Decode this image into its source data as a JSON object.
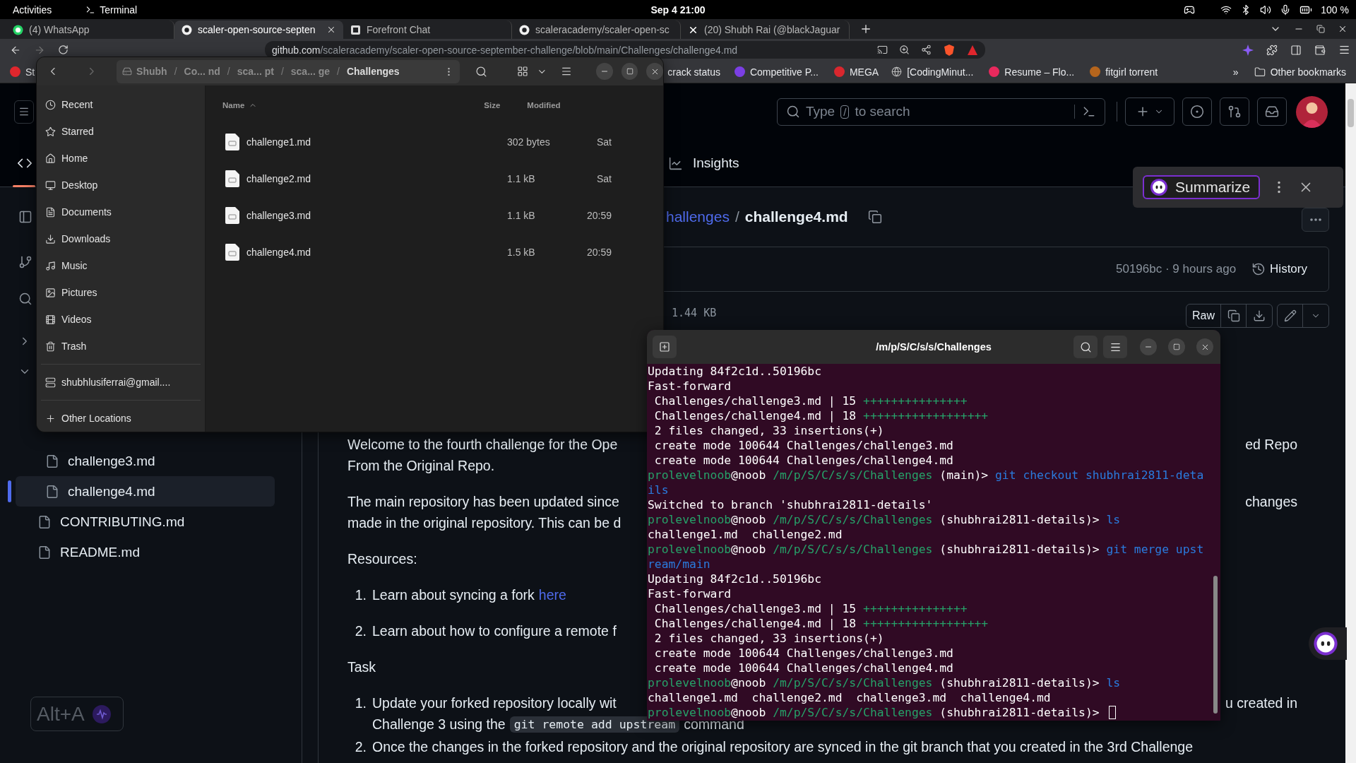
{
  "top_bar": {
    "activities": "Activities",
    "app": "Terminal",
    "clock": "Sep 4 21:00",
    "battery": "100 %"
  },
  "browser": {
    "tabs": [
      {
        "title": "(4) WhatsApp",
        "kind": "chat",
        "selected": false
      },
      {
        "title": "scaler-open-source-septen",
        "kind": "github",
        "selected": true
      },
      {
        "title": "Forefront Chat",
        "kind": "forefront",
        "selected": false
      },
      {
        "title": "scaleracademy/scaler-open-sc",
        "kind": "github",
        "selected": false
      },
      {
        "title": "(20) Shubh Rai (@blackJaguar",
        "kind": "x",
        "selected": false
      }
    ],
    "url": {
      "host": "github.com",
      "path": "/scaleracademy/scaler-open-source-september-challenge/blob/main/Challenges/challenge4.md"
    },
    "bookmarks": [
      {
        "label": "St",
        "kind": "dot",
        "color": "#e0262d"
      },
      {
        "label": "crack status",
        "kind": "none"
      },
      {
        "label": "Competitive P...",
        "kind": "dot",
        "color": "#7b3fe4"
      },
      {
        "label": "MEGA",
        "kind": "dot",
        "color": "#d9272e"
      },
      {
        "label": "[CodingMinut...",
        "kind": "globe"
      },
      {
        "label": "Resume – Flo...",
        "kind": "dot",
        "color": "#e8295d"
      },
      {
        "label": "fitgirl torrent",
        "kind": "dot",
        "color": "#b5651d"
      }
    ],
    "more": "»",
    "other_bookmarks": "Other bookmarks"
  },
  "github": {
    "search": {
      "before": "Type",
      "key": "/",
      "after": "to search"
    },
    "insights": "Insights",
    "breadcrumb": {
      "parent": "hallenges",
      "separator": "/",
      "file": "challenge4.md"
    },
    "commit": {
      "info": "50196bc · 9 hours ago",
      "history": "History"
    },
    "file_size": "1.44 KB",
    "raw": "Raw",
    "file_tree": [
      {
        "children": [
          {
            "name": "challenge3.md",
            "selected": false
          },
          {
            "name": "challenge4.md",
            "selected": true
          }
        ]
      },
      {
        "name": "CONTRIBUTING.md",
        "selected": false
      },
      {
        "name": "README.md",
        "selected": false
      }
    ],
    "content": [
      {
        "kind": "paragraph",
        "lines": [
          {
            "text": "Welcome to the fourth challenge for the Ope",
            "right": "ed Repo"
          },
          {
            "text": "From the Original Repo."
          }
        ]
      },
      {
        "kind": "paragraph",
        "lines": [
          {
            "text": "The main repository has been updated since",
            "right": "changes"
          },
          {
            "text": "made in the original repository. This can be d"
          }
        ]
      },
      {
        "kind": "paragraph",
        "lines": [
          {
            "text": "Resources:"
          }
        ]
      },
      {
        "kind": "list",
        "loose": true,
        "items": [
          {
            "number": "1.",
            "lines": [
              {
                "text": "Learn about syncing a fork",
                "link": "here"
              }
            ]
          },
          {
            "number": "2.",
            "lines": [
              {
                "text": "Learn about how to configure a remote f"
              }
            ]
          }
        ]
      },
      {
        "kind": "paragraph",
        "lines": [
          {
            "text": "Task"
          }
        ]
      },
      {
        "kind": "list",
        "loose": false,
        "items": [
          {
            "number": "1.",
            "lines": [
              {
                "text": "Update your forked repository locally wit",
                "right": "u created in"
              },
              {
                "text": "Challenge 3 using the",
                "code": "git remote add upstream",
                "after": "command"
              }
            ]
          },
          {
            "number": "2.",
            "lines": [
              {
                "text": "Once the changes in the forked repository and the original repository are synced in the git branch that you created in the 3rd Challenge"
              }
            ]
          }
        ]
      }
    ],
    "summarize": "Summarize",
    "alt_a": "Alt+A"
  },
  "file_manager": {
    "path": [
      "Shubh",
      "Co... nd",
      "sca... pt",
      "sca... ge",
      "Challenges"
    ],
    "separator": "/",
    "sidebar_sections": [
      {
        "items": [
          {
            "label": "Recent",
            "kind": "recent",
            "selected": false
          },
          {
            "label": "Starred",
            "kind": "starred",
            "selected": false
          },
          {
            "label": "Home",
            "kind": "home",
            "selected": false
          },
          {
            "label": "Desktop",
            "kind": "desktop",
            "selected": false
          },
          {
            "label": "Documents",
            "kind": "documents",
            "selected": false
          },
          {
            "label": "Downloads",
            "kind": "downloads",
            "selected": false
          },
          {
            "label": "Music",
            "kind": "music",
            "selected": false
          },
          {
            "label": "Pictures",
            "kind": "pictures",
            "selected": false
          },
          {
            "label": "Videos",
            "kind": "videos",
            "selected": false
          },
          {
            "label": "Trash",
            "kind": "trash",
            "selected": false
          }
        ]
      },
      {
        "items": [
          {
            "label": "shubhlusiferrai@gmail....",
            "kind": "account",
            "selected": false
          }
        ]
      },
      {
        "items": [
          {
            "label": "Other Locations",
            "kind": "other",
            "selected": false
          }
        ]
      }
    ],
    "columns": {
      "name": "Name",
      "size": "Size",
      "modified": "Modified"
    },
    "files": [
      {
        "name": "challenge1.md",
        "size": "302 bytes",
        "modified": "Sat",
        "selected": false
      },
      {
        "name": "challenge2.md",
        "size": "1.1 kB",
        "modified": "Sat",
        "selected": false
      },
      {
        "name": "challenge3.md",
        "size": "1.1 kB",
        "modified": "20:59",
        "selected": false
      },
      {
        "name": "challenge4.md",
        "size": "1.5 kB",
        "modified": "20:59",
        "selected": false
      }
    ]
  },
  "terminal": {
    "title": "/m/p/S/C/s/s/Challenges",
    "lines": [
      {
        "kind": "output",
        "text": "Updating 84f2c1d..50196bc"
      },
      {
        "kind": "output",
        "text": "Fast-forward"
      },
      {
        "kind": "output",
        "text": " Challenges/challenge3.md | 15 ",
        "plus": "+++++++++++++++"
      },
      {
        "kind": "output",
        "text": " Challenges/challenge4.md | 18 ",
        "plus": "++++++++++++++++++"
      },
      {
        "kind": "output",
        "text": " 2 files changed, 33 insertions(+)"
      },
      {
        "kind": "output",
        "text": " create mode 100644 Challenges/challenge3.md"
      },
      {
        "kind": "output",
        "text": " create mode 100644 Challenges/challenge4.md"
      },
      {
        "kind": "prompt",
        "user": "prolevelnoob",
        "host": "@noob",
        "path": "/m/p/S/C/s/s/Challenges",
        "branch": "(main)>",
        "command": "git checkout shubhrai2811-details",
        "cursor": false
      },
      {
        "kind": "output",
        "text": "Switched to branch 'shubhrai2811-details'"
      },
      {
        "kind": "prompt",
        "user": "prolevelnoob",
        "host": "@noob",
        "path": "/m/p/S/C/s/s/Challenges",
        "branch": "(shubhrai2811-details)>",
        "command": "ls",
        "cursor": false
      },
      {
        "kind": "output",
        "text": "challenge1.md  challenge2.md"
      },
      {
        "kind": "prompt",
        "user": "prolevelnoob",
        "host": "@noob",
        "path": "/m/p/S/C/s/s/Challenges",
        "branch": "(shubhrai2811-details)>",
        "command": "git merge upstream/main",
        "cursor": false
      },
      {
        "kind": "output",
        "text": "Updating 84f2c1d..50196bc"
      },
      {
        "kind": "output",
        "text": "Fast-forward"
      },
      {
        "kind": "output",
        "text": " Challenges/challenge3.md | 15 ",
        "plus": "+++++++++++++++"
      },
      {
        "kind": "output",
        "text": " Challenges/challenge4.md | 18 ",
        "plus": "++++++++++++++++++"
      },
      {
        "kind": "output",
        "text": " 2 files changed, 33 insertions(+)"
      },
      {
        "kind": "output",
        "text": " create mode 100644 Challenges/challenge3.md"
      },
      {
        "kind": "output",
        "text": " create mode 100644 Challenges/challenge4.md"
      },
      {
        "kind": "prompt",
        "user": "prolevelnoob",
        "host": "@noob",
        "path": "/m/p/S/C/s/s/Challenges",
        "branch": "(shubhrai2811-details)>",
        "command": "ls",
        "cursor": false
      },
      {
        "kind": "output",
        "text": "challenge1.md  challenge2.md  challenge3.md  challenge4.md"
      },
      {
        "kind": "prompt",
        "user": "prolevelnoob",
        "host": "@noob",
        "path": "/m/p/S/C/s/s/Challenges",
        "branch": "(shubhrai2811-details)>",
        "cursor": true
      }
    ]
  }
}
